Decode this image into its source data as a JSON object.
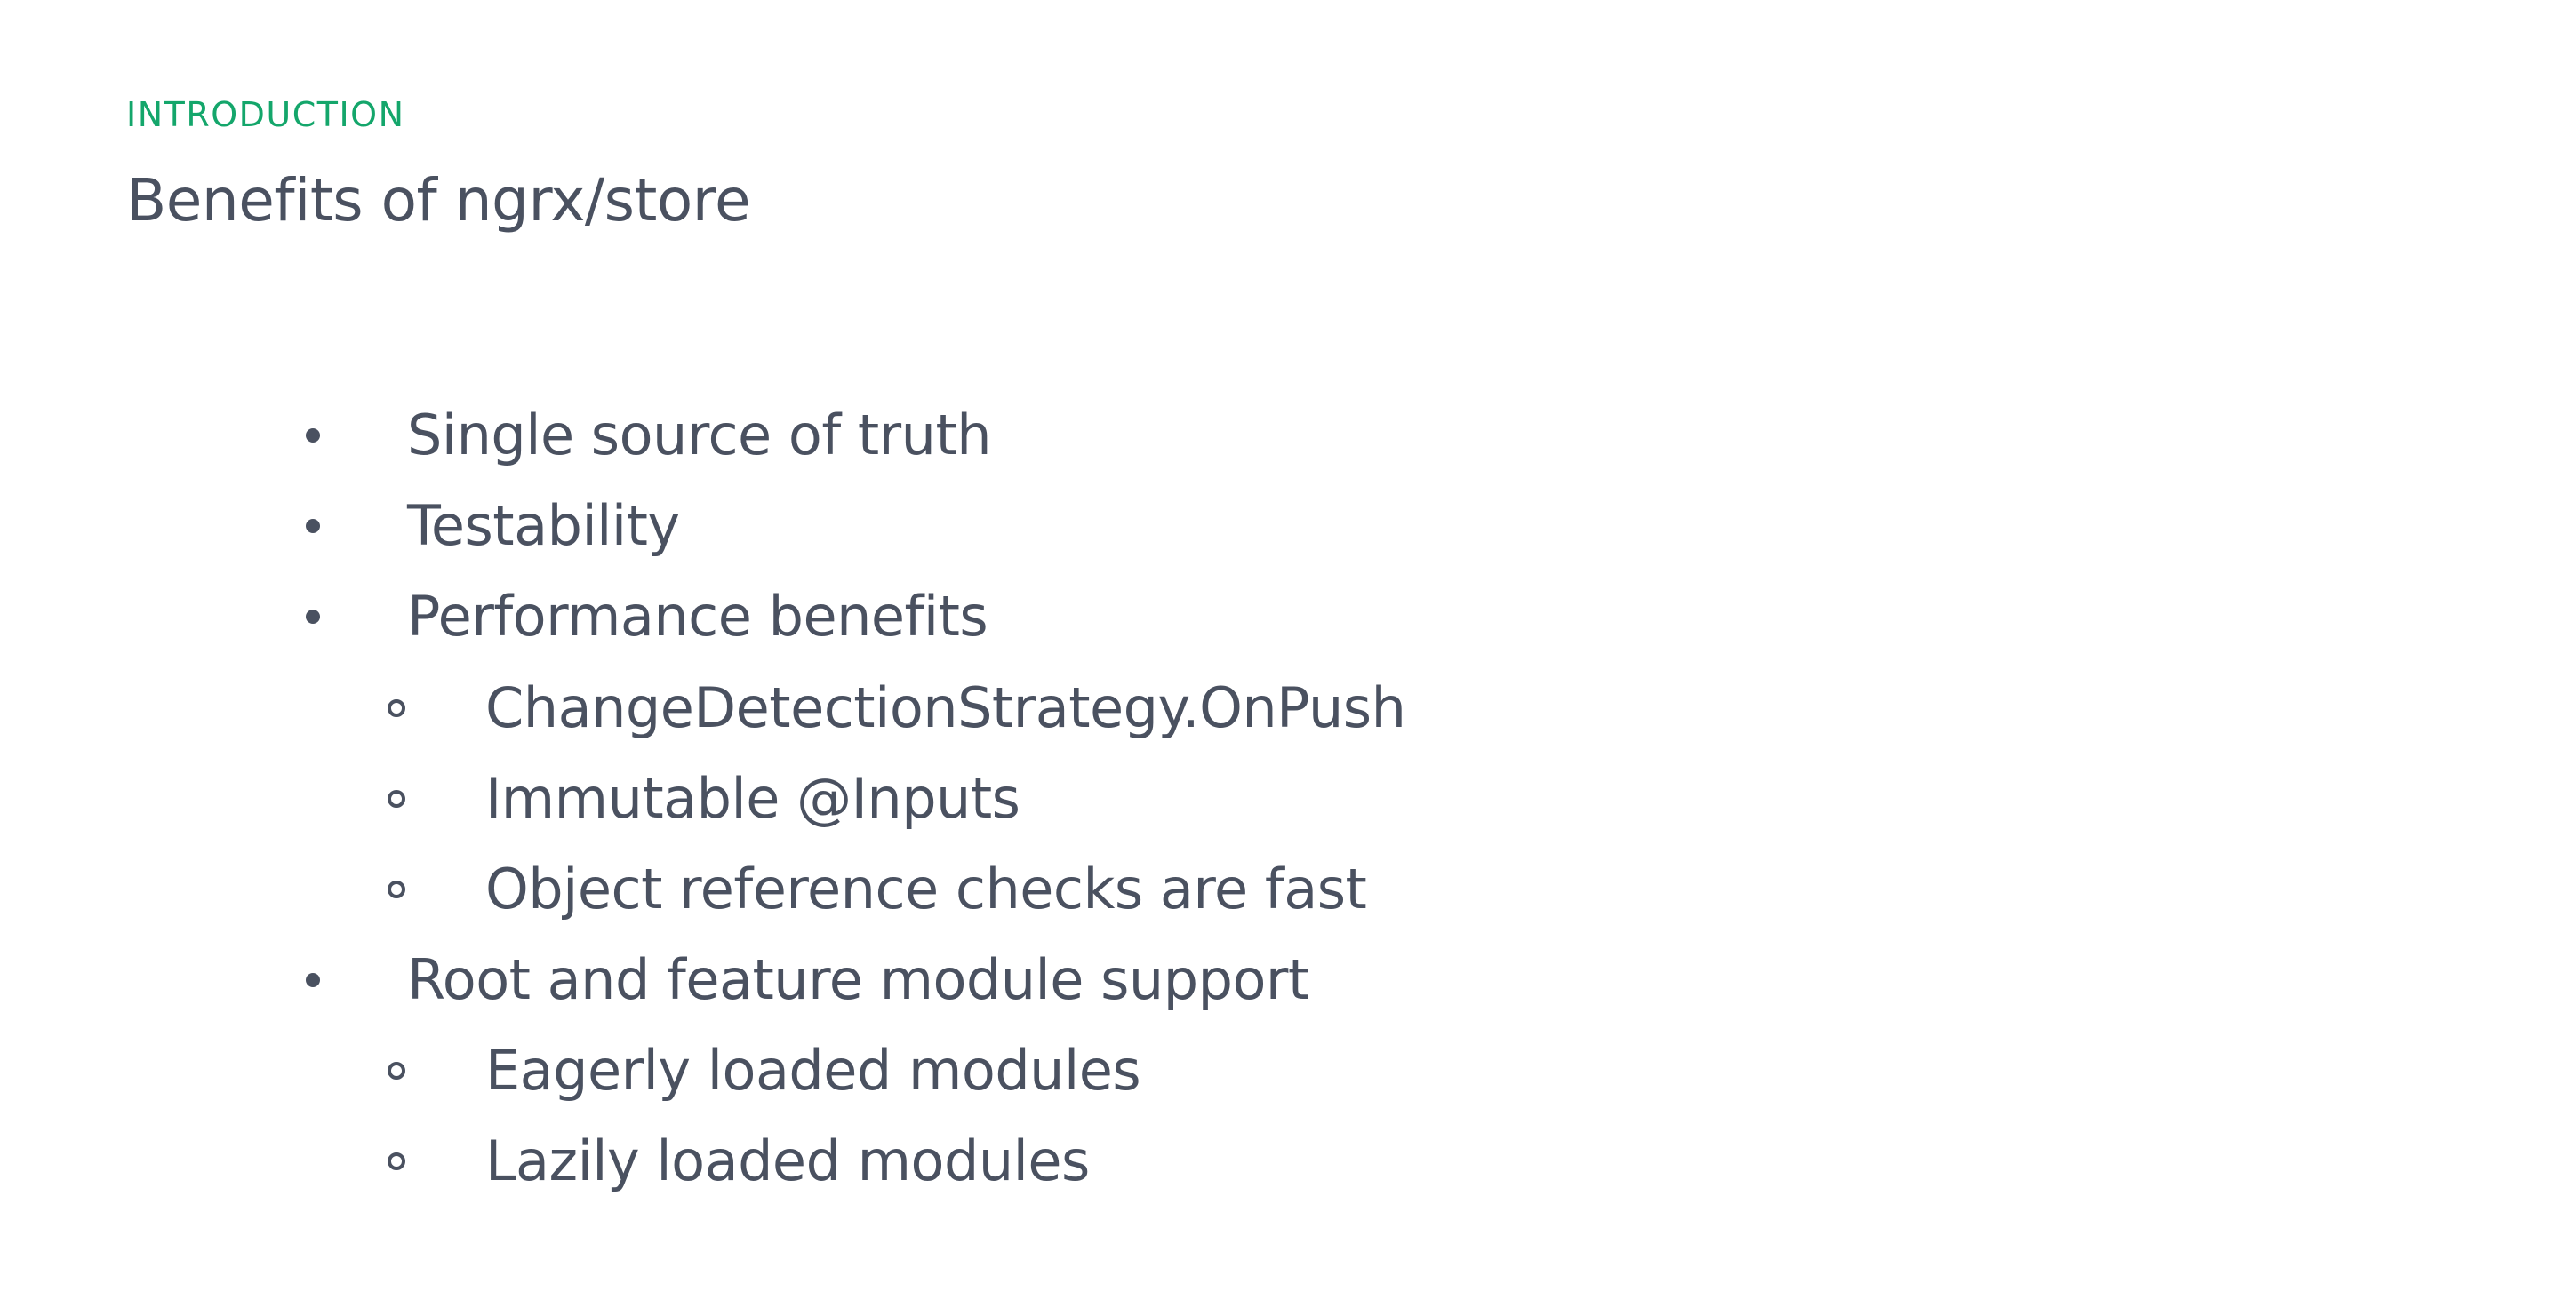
{
  "slide": {
    "eyebrow": "INTRODUCTION",
    "title": "Benefits of ngrx/store",
    "bullets": [
      {
        "level": 1,
        "marker": "filled-dot",
        "text": "Single source of truth"
      },
      {
        "level": 1,
        "marker": "filled-dot",
        "text": "Testability"
      },
      {
        "level": 1,
        "marker": "filled-dot",
        "text": "Performance benefits"
      },
      {
        "level": 2,
        "marker": "hollow-circle",
        "text": "ChangeDetectionStrategy.OnPush"
      },
      {
        "level": 2,
        "marker": "hollow-circle",
        "text": "Immutable @Inputs"
      },
      {
        "level": 2,
        "marker": "hollow-circle",
        "text": "Object reference checks are fast"
      },
      {
        "level": 1,
        "marker": "filled-dot",
        "text": "Root and feature module support"
      },
      {
        "level": 2,
        "marker": "hollow-circle",
        "text": "Eagerly loaded modules"
      },
      {
        "level": 2,
        "marker": "hollow-circle",
        "text": "Lazily loaded modules"
      }
    ]
  },
  "colors": {
    "accent": "#14a66b",
    "text": "#4a5160",
    "background": "#ffffff"
  }
}
